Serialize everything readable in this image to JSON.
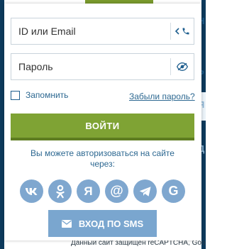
{
  "background": {
    "right_fragments": [
      {
        "text": "H",
        "tone": "dark"
      },
      {
        "text": "P",
        "tone": "dark"
      },
      {
        "text": "Я",
        "tone": "pale"
      },
      {
        "text": "Д",
        "tone": "pale"
      }
    ],
    "bottom_text": "Данный сайт защищен reCAPTCHA, Google"
  },
  "form": {
    "login_placeholder": "ID или Email",
    "password_placeholder": "Пароль",
    "remember_label": "Запомнить",
    "forgot_link": "Забыли пароль?",
    "login_button": "ВОЙТИ",
    "social_caption": "Вы можете авторизоваться на сайте через:",
    "sms_button": "ВХОД ПО SMS"
  },
  "social": [
    {
      "icon": "vk-icon",
      "glyph": "vk"
    },
    {
      "icon": "odnoklassniki-icon",
      "glyph": "ok"
    },
    {
      "icon": "yandex-icon",
      "glyph": "Я"
    },
    {
      "icon": "mail-ru-icon",
      "glyph": "@"
    },
    {
      "icon": "telegram-icon",
      "glyph": "tg"
    },
    {
      "icon": "google-icon",
      "glyph": "G"
    }
  ],
  "colors": {
    "accent_green": "#7fa334",
    "link_blue": "#2d6891",
    "social_blue": "#7fa7cf",
    "bg_navy": "#0d3a5c"
  }
}
